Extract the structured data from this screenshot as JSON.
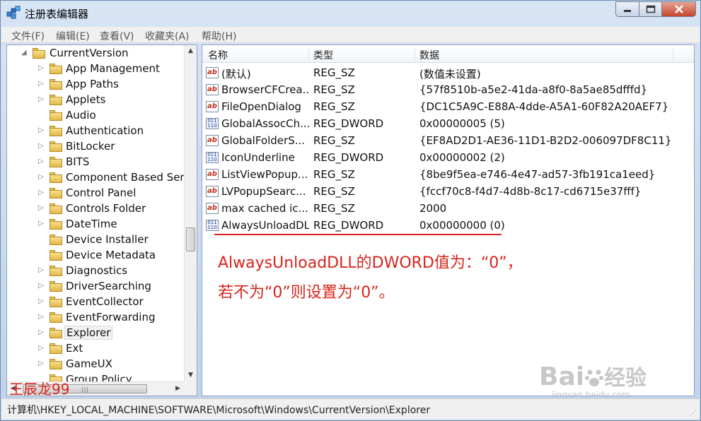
{
  "window": {
    "title": "注册表编辑器"
  },
  "menu": [
    "文件(F)",
    "编辑(E)",
    "查看(V)",
    "收藏夹(A)",
    "帮助(H)"
  ],
  "tree": {
    "items": [
      {
        "label": "CurrentVersion",
        "expanded": true,
        "level": 0
      },
      {
        "label": "App Management",
        "level": 1
      },
      {
        "label": "App Paths",
        "level": 1
      },
      {
        "label": "Applets",
        "level": 1
      },
      {
        "label": "Audio",
        "level": 1
      },
      {
        "label": "Authentication",
        "level": 1
      },
      {
        "label": "BitLocker",
        "level": 1
      },
      {
        "label": "BITS",
        "level": 1
      },
      {
        "label": "Component Based Serv",
        "level": 1
      },
      {
        "label": "Control Panel",
        "level": 1
      },
      {
        "label": "Controls Folder",
        "level": 1
      },
      {
        "label": "DateTime",
        "level": 1
      },
      {
        "label": "Device Installer",
        "level": 1
      },
      {
        "label": "Device Metadata",
        "level": 1
      },
      {
        "label": "Diagnostics",
        "level": 1
      },
      {
        "label": "DriverSearching",
        "level": 1
      },
      {
        "label": "EventCollector",
        "level": 1
      },
      {
        "label": "EventForwarding",
        "level": 1
      },
      {
        "label": "Explorer",
        "level": 1,
        "selected": true
      },
      {
        "label": "Ext",
        "level": 1
      },
      {
        "label": "GameUX",
        "level": 1
      },
      {
        "label": "Group Policy",
        "level": 1
      }
    ]
  },
  "list": {
    "columns": [
      "名称",
      "类型",
      "数据"
    ],
    "rows": [
      {
        "icon": "string",
        "name": "(默认)",
        "type": "REG_SZ",
        "data": "(数值未设置)"
      },
      {
        "icon": "string",
        "name": "BrowserCFCrea...",
        "type": "REG_SZ",
        "data": "{57f8510b-a5e2-41da-a8f0-8a5ae85dfffd}"
      },
      {
        "icon": "string",
        "name": "FileOpenDialog",
        "type": "REG_SZ",
        "data": "{DC1C5A9C-E88A-4dde-A5A1-60F82A20AEF7}"
      },
      {
        "icon": "dword",
        "name": "GlobalAssocCh...",
        "type": "REG_DWORD",
        "data": "0x00000005 (5)"
      },
      {
        "icon": "string",
        "name": "GlobalFolderS...",
        "type": "REG_SZ",
        "data": "{EF8AD2D1-AE36-11D1-B2D2-006097DF8C11}"
      },
      {
        "icon": "dword",
        "name": "IconUnderline",
        "type": "REG_DWORD",
        "data": "0x00000002 (2)"
      },
      {
        "icon": "string",
        "name": "ListViewPopup...",
        "type": "REG_SZ",
        "data": "{8be9f5ea-e746-4e47-ad57-3fb191ca1eed}"
      },
      {
        "icon": "string",
        "name": "LVPopupSearc...",
        "type": "REG_SZ",
        "data": "{fccf70c8-f4d7-4d8b-8c17-cd6715e37fff}"
      },
      {
        "icon": "string",
        "name": "max cached ic...",
        "type": "REG_SZ",
        "data": "2000"
      },
      {
        "icon": "dword",
        "name": "AlwaysUnloadDL",
        "type": "REG_DWORD",
        "data": "0x00000000 (0)"
      }
    ]
  },
  "annotation": {
    "line1": "AlwaysUnloadDLL的DWORD值为：“0”，",
    "line2": "若不为“0”则设置为“0”。"
  },
  "status": {
    "path": "计算机\\HKEY_LOCAL_MACHINE\\SOFTWARE\\Microsoft\\Windows\\CurrentVersion\\Explorer"
  },
  "watermarks": {
    "author": "王辰龙99",
    "brand": "Bai",
    "brand_cn": "经验",
    "site": "jingyan.baidu.com"
  },
  "icons": {
    "string_value": "ab",
    "dword_value": "011 110"
  },
  "colors": {
    "annotation_red": "#d8231c"
  }
}
